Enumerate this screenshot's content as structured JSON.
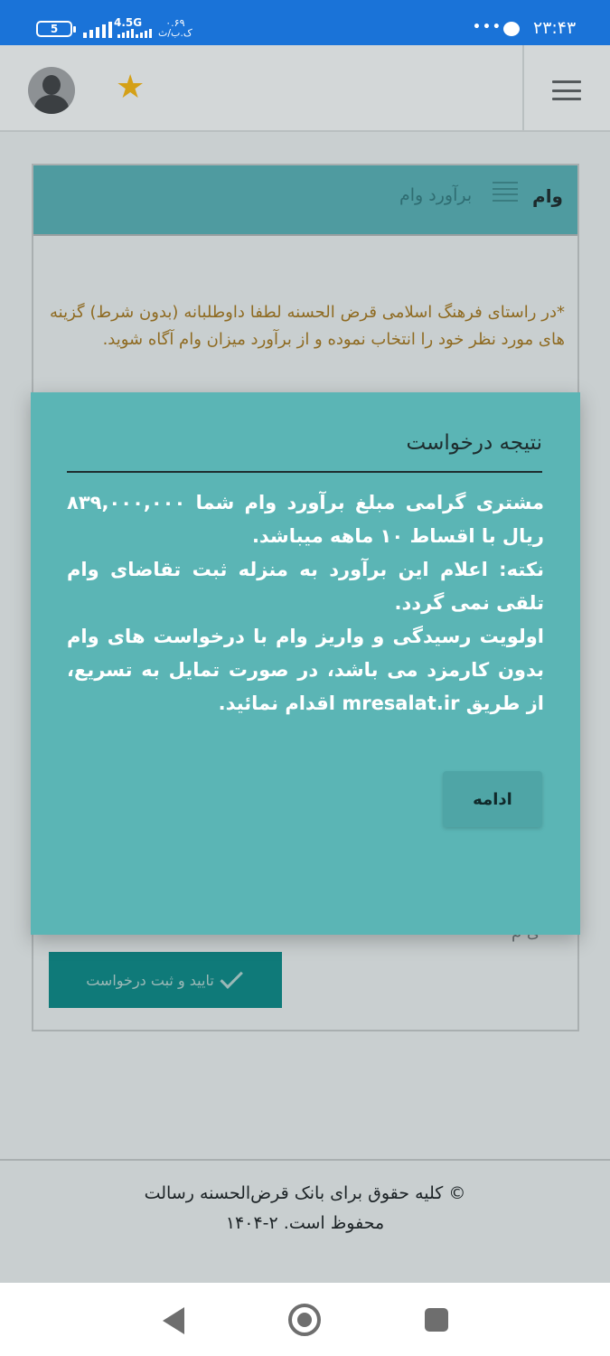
{
  "status_bar": {
    "battery": "5",
    "network": "4.5G",
    "speed_top": "۰.۶۹",
    "speed_bottom": "ک.ب/ث",
    "dots": "•••",
    "time": "۲۳:۴۳"
  },
  "header": {
    "avatar_icon": "user-avatar-icon",
    "star_icon": "★",
    "menu_icon": "hamburger-icon"
  },
  "card": {
    "breadcrumb_active": "وام",
    "breadcrumb_current": "برآورد وام",
    "note": "*در راستای فرهنگ اسلامی قرض الحسنه لطفا داوطلبانه (بدون شرط) گزینه های مورد نظر خود را انتخاب نموده و از برآورد میزان وام آگاه شوید.",
    "partial_text": "ی  م",
    "submit_label": "تایید و ثبت درخواست"
  },
  "modal": {
    "title": "نتیجه درخواست",
    "body_line1": "مشتری گرامی مبلغ برآورد وام شما ۸۳۹,۰۰۰,۰۰۰ ریال با اقساط ۱۰ ماهه میباشد.",
    "body_line2": "نکته: اعلام این برآورد به منزله ثبت تقاضای وام تلقی نمی گردد.",
    "body_line3": "اولویت رسیدگی و واریز وام با درخواست های وام بدون کارمزد می باشد، در صورت تمایل به تسریع، از طریق mresalat.ir اقدام نمائید.",
    "continue_label": "ادامه"
  },
  "footer": {
    "copyright": "© کلیه حقوق برای بانک قرض‌الحسنه رسالت محفوظ است. ۲-۱۴۰۴"
  },
  "colors": {
    "status_bar": "#1a73d8",
    "modal_bg": "#5bb5b5",
    "card_header": "#4f9ba0",
    "submit_button": "#0f7a79",
    "star": "#d4a017",
    "note_text": "#8f6b22"
  }
}
